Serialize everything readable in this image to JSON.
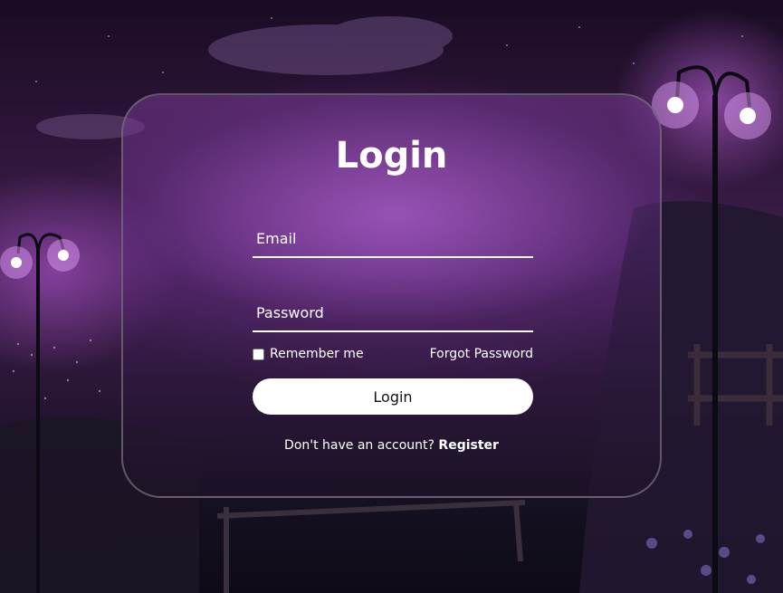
{
  "form": {
    "title": "Login",
    "email_placeholder": "Email",
    "password_placeholder": "Password",
    "remember_label": "Remember me",
    "forgot_label": "Forgot Password",
    "login_button_label": "Login",
    "no_account_text": "Don't have an account?",
    "register_label": "Register"
  },
  "colors": {
    "accent": "#ffffff",
    "background_purple": "#40204f"
  }
}
